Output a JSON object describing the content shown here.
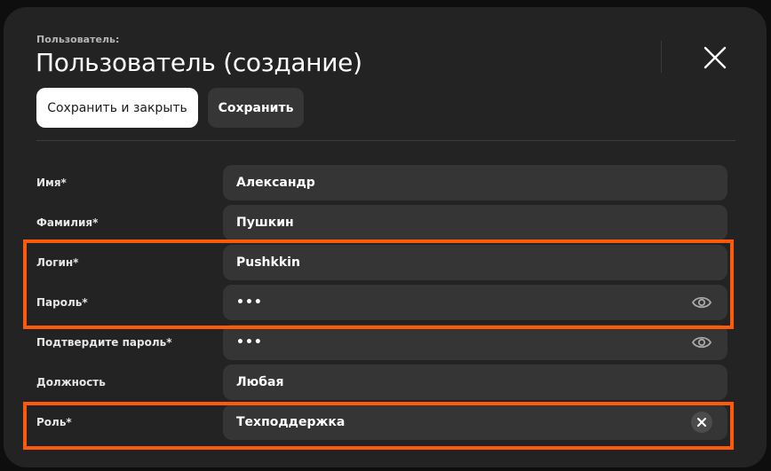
{
  "header": {
    "breadcrumb": "Пользователь:",
    "title": "Пользователь (создание)"
  },
  "toolbar": {
    "save_close_label": "Сохранить и закрыть",
    "save_label": "Сохранить"
  },
  "form": {
    "first_name": {
      "label": "Имя*",
      "value": "Александр"
    },
    "last_name": {
      "label": "Фамилия*",
      "value": "Пушкин"
    },
    "login": {
      "label": "Логин*",
      "value": "Pushkkin"
    },
    "password": {
      "label": "Пароль*",
      "masked_value": "•••"
    },
    "confirm_password": {
      "label": "Подтвердите пароль*",
      "masked_value": "•••"
    },
    "position": {
      "label": "Должность",
      "value": "Любая"
    },
    "role": {
      "label": "Роль*",
      "value": "Техподдержка"
    }
  },
  "icons": {
    "close": "close-icon",
    "show_password": "eye-icon",
    "clear_role": "clear-icon"
  },
  "colors": {
    "modal_background": "#232323",
    "field_background": "#353535",
    "primary_button": "#ffffff",
    "secondary_button": "#363636",
    "highlight": "#ff5a0a"
  }
}
